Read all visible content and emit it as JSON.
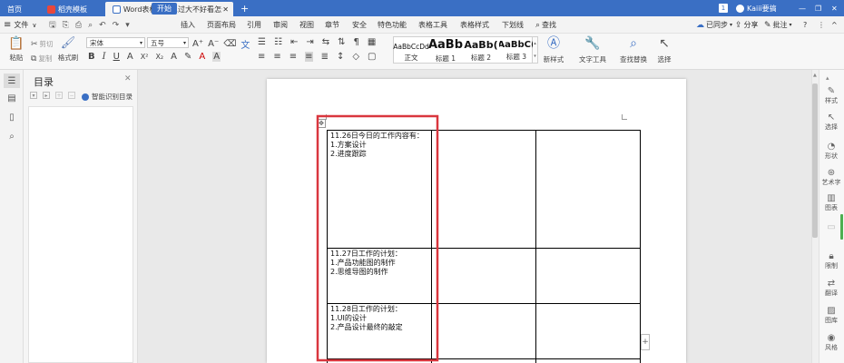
{
  "titlebar": {
    "tabs": [
      {
        "label": "首页",
        "active": false
      },
      {
        "label": "稻壳模板",
        "active": false
      },
      {
        "label": "Word表格中的...过大不好看怎么办",
        "active": true
      }
    ],
    "new_tab": "+",
    "page_badge": "1",
    "user": "Kaiii要搞",
    "win_min": "—",
    "win_max": "❐",
    "win_close": "✕"
  },
  "menubar": {
    "file": "文件",
    "items": [
      "开始",
      "插入",
      "页面布局",
      "引用",
      "审阅",
      "视图",
      "章节",
      "安全",
      "特色功能",
      "表格工具",
      "表格样式",
      "下划线"
    ],
    "search": "查找",
    "sync": "已同步",
    "share": "分享",
    "comment": "批注",
    "help": "?",
    "more": "⋮",
    "collapse": "^"
  },
  "ribbon": {
    "paste": "粘贴",
    "cut": "剪切",
    "copy": "复制",
    "format_painter": "格式刷",
    "font_name": "宋体",
    "font_size": "五号",
    "styles": [
      {
        "preview": "AaBbCcDd",
        "label": "正文"
      },
      {
        "preview": "AaBb",
        "label": "标题 1"
      },
      {
        "preview": "AaBb(",
        "label": "标题 2"
      },
      {
        "preview": "AaBbC(",
        "label": "标题 3"
      }
    ],
    "new_style": "新样式",
    "text_tools": "文字工具",
    "find_replace": "查找替换",
    "select": "选择"
  },
  "navpane": {
    "title": "目录",
    "smart_toc": "智能识别目录"
  },
  "table": {
    "rows": [
      {
        "lines": [
          "11.26日今日的工作内容有：",
          "1.方案设计",
          "2.进度跟踪"
        ]
      },
      {
        "lines": [
          "11.27日工作的计划：",
          "1.产品功能图的制作",
          "2.思维导图的制作"
        ]
      },
      {
        "lines": [
          "11.28日工作的计划：",
          "1.UI的设计",
          "2.产品设计最终的敲定"
        ]
      }
    ],
    "add_col": "+"
  },
  "rightrail": {
    "items": [
      "样式",
      "选择",
      "形状",
      "艺术字",
      "图表",
      "",
      "限制",
      "翻译",
      "图库",
      "风格"
    ]
  },
  "colors": {
    "accent": "#3a6fc4",
    "highlight_box": "#d9363e"
  }
}
